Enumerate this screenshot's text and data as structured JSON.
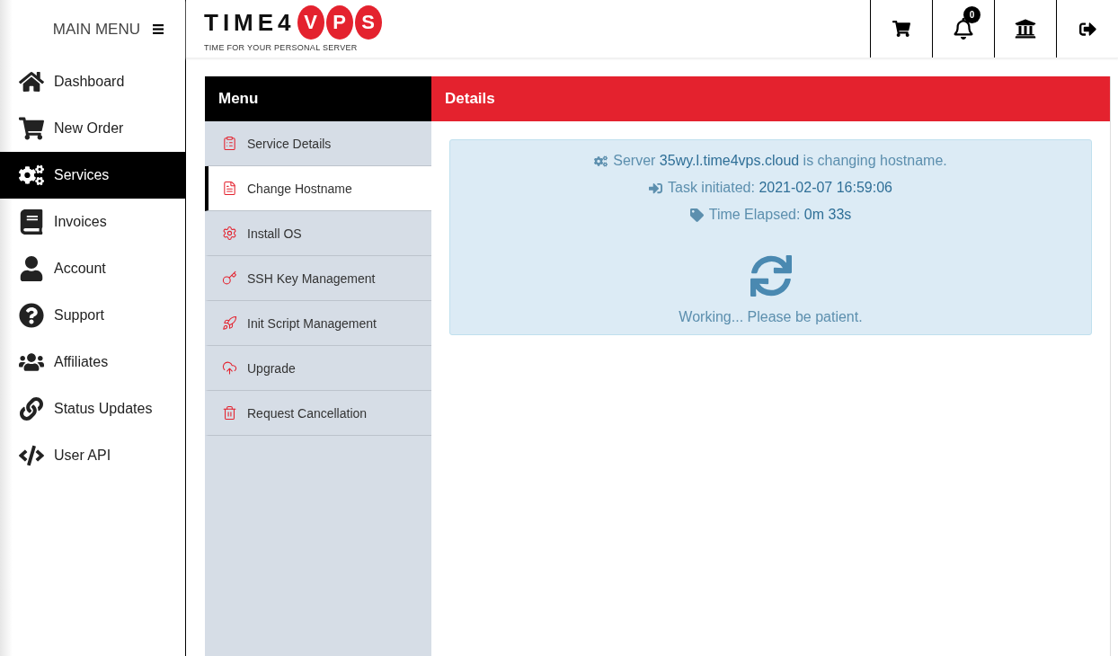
{
  "sidebar": {
    "title": "MAIN MENU",
    "items": [
      {
        "label": "Dashboard",
        "selected": false
      },
      {
        "label": "New Order",
        "selected": false
      },
      {
        "label": "Services",
        "selected": true
      },
      {
        "label": "Invoices",
        "selected": false
      },
      {
        "label": "Account",
        "selected": false
      },
      {
        "label": "Support",
        "selected": false
      },
      {
        "label": "Affiliates",
        "selected": false
      },
      {
        "label": "Status Updates",
        "selected": false
      },
      {
        "label": "User API",
        "selected": false
      }
    ]
  },
  "logo": {
    "word": "TIME4",
    "letters": [
      "V",
      "P",
      "S"
    ],
    "tagline": "TIME FOR YOUR PERSONAL SERVER"
  },
  "toolbar": {
    "notification_count": "0"
  },
  "menu": {
    "title": "Menu",
    "items": [
      {
        "label": "Service Details",
        "selected": false
      },
      {
        "label": "Change Hostname",
        "selected": true
      },
      {
        "label": "Install OS",
        "selected": false
      },
      {
        "label": "SSH Key Management",
        "selected": false
      },
      {
        "label": "Init Script Management",
        "selected": false
      },
      {
        "label": "Upgrade",
        "selected": false
      },
      {
        "label": "Request Cancellation",
        "selected": false
      }
    ]
  },
  "details": {
    "title": "Details",
    "lines": [
      "Server **35wy.l.time4vps.cloud** is changing hostname.",
      "Task initiated: **2021-02-07 16:59:06**",
      "Time Elapsed: **0m 33s**"
    ],
    "status": "Working... Please be patient."
  }
}
